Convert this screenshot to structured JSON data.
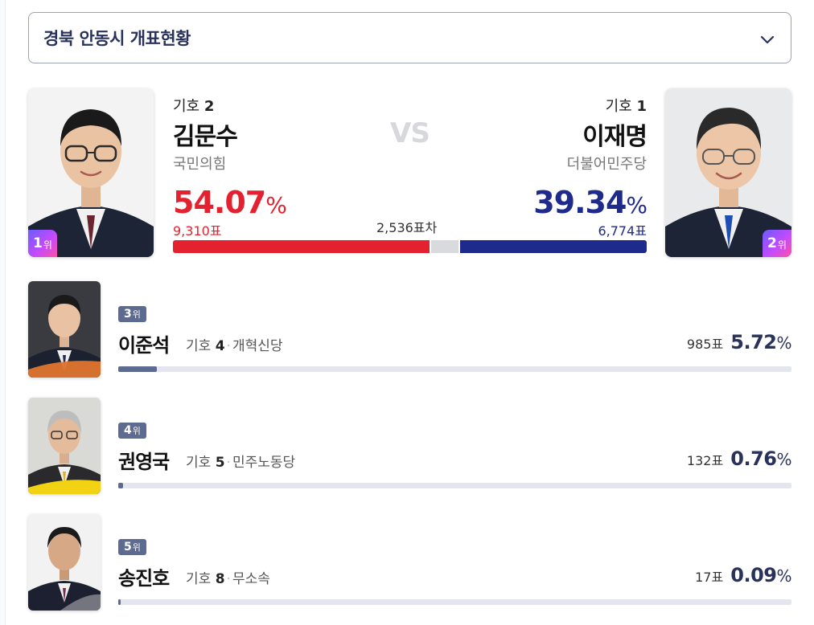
{
  "region": {
    "title": "경북 안동시 개표현황",
    "icon": "chevron-down-icon"
  },
  "vs_label": "VS",
  "winner": {
    "giho_prefix": "기호",
    "giho_num": "2",
    "name": "김문수",
    "party": "국민의힘",
    "pct": "54.07",
    "pct_unit": "%",
    "votes": "9,310표",
    "rank_num": "1",
    "rank_suffix": "위",
    "color": "#e4222f"
  },
  "runner": {
    "giho_prefix": "기호",
    "giho_num": "1",
    "name": "이재명",
    "party": "더불어민주당",
    "pct": "39.34",
    "pct_unit": "%",
    "votes": "6,774표",
    "rank_num": "2",
    "rank_suffix": "위",
    "color": "#1f2b8c"
  },
  "gap_text": "2,536표차",
  "head_bar": {
    "winner_share": 0.5407,
    "runner_share": 0.3934
  },
  "others": [
    {
      "rank_num": "3",
      "rank_suffix": "위",
      "name": "이준석",
      "giho_prefix": "기호",
      "giho_num": "4",
      "party": "개혁신당",
      "votes": "985표",
      "pct": "5.72",
      "pct_unit": "%",
      "share": 0.0572
    },
    {
      "rank_num": "4",
      "rank_suffix": "위",
      "name": "권영국",
      "giho_prefix": "기호",
      "giho_num": "5",
      "party": "민주노동당",
      "votes": "132표",
      "pct": "0.76",
      "pct_unit": "%",
      "share": 0.0076
    },
    {
      "rank_num": "5",
      "rank_suffix": "위",
      "name": "송진호",
      "giho_prefix": "기호",
      "giho_num": "8",
      "party": "무소속",
      "votes": "17표",
      "pct": "0.09",
      "pct_unit": "%",
      "share": 0.0009
    }
  ]
}
